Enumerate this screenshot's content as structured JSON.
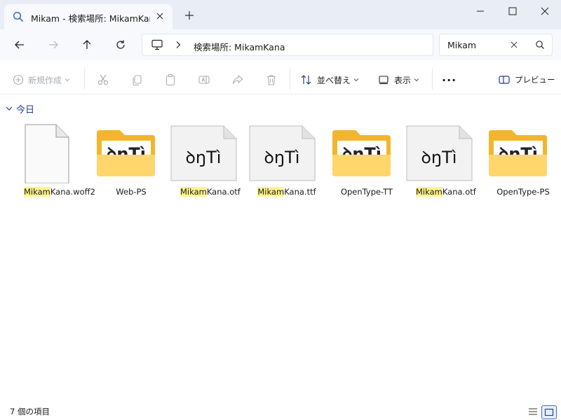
{
  "window": {
    "tab_title": "Mikam - 検索場所: MikamKana",
    "address_location": "検索場所: MikamKana",
    "search_value": "Mikam"
  },
  "toolbar": {
    "new_label": "新規作成",
    "sort_label": "並べ替え",
    "view_label": "表示",
    "more_label": "···",
    "preview_label": "プレビュー"
  },
  "group": {
    "label": "今日"
  },
  "files": [
    {
      "match": "Mikam",
      "rest": "Kana.woff2",
      "type": "file"
    },
    {
      "match": "",
      "rest": "Web-PS",
      "type": "folder"
    },
    {
      "match": "Mikam",
      "rest": "Kana.otf",
      "type": "font"
    },
    {
      "match": "Mikam",
      "rest": "Kana.ttf",
      "type": "font"
    },
    {
      "match": "",
      "rest": "OpenType-TT",
      "type": "folder"
    },
    {
      "match": "Mikam",
      "rest": "Kana.otf",
      "type": "font"
    },
    {
      "match": "",
      "rest": "OpenType-PS",
      "type": "folder"
    }
  ],
  "font_preview_glyphs": "ꝺŋTì",
  "status": {
    "item_count": "7 個の項目"
  },
  "colors": {
    "accent": "#1f3f8a",
    "highlight": "#fff58a",
    "folder_back": "#f3b62a",
    "folder_front": "#ffd66b"
  }
}
